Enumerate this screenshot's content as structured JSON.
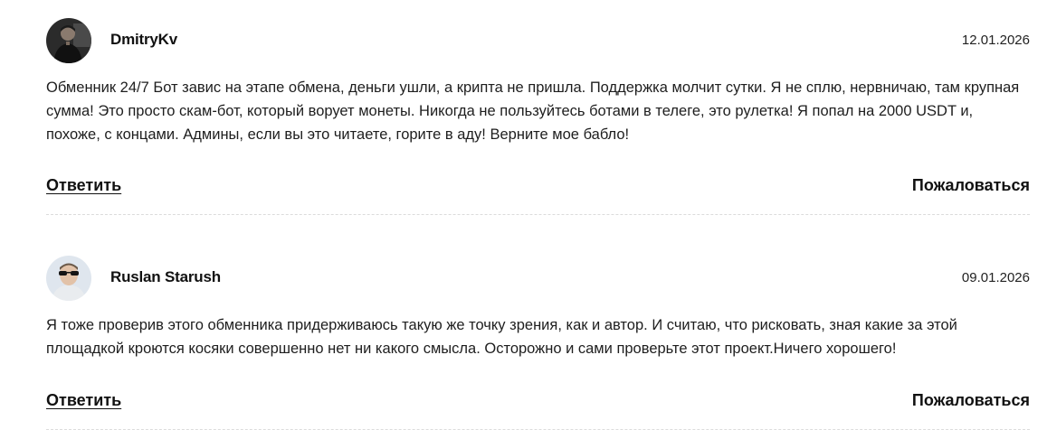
{
  "comments": [
    {
      "author": "DmitryKv",
      "date": "12.01.2026",
      "text": "Обменник 24/7 Бот завис на этапе обмена, деньги ушли, а крипта не пришла. Поддержка молчит сутки. Я не сплю, нервничаю, там крупная сумма! Это просто скам-бот, который ворует монеты. Никогда не пользуйтесь ботами в телеге, это рулетка! Я попал на 2000 USDT и, похоже, с концами. Админы, если вы это читаете, горите в аду! Верните мое бабло!",
      "reply_label": "Ответить",
      "report_label": "Пожаловаться"
    },
    {
      "author": "Ruslan Starush",
      "date": "09.01.2026",
      "text": "Я тоже проверив этого обменника придерживаюсь такую же точку зрения, как и автор. И считаю, что рисковать, зная какие за этой площадкой кроются косяки совершенно нет ни какого смысла. Осторожно и сами проверьте этот проект.Ничего хорошего!",
      "reply_label": "Ответить",
      "report_label": "Пожаловаться"
    }
  ]
}
